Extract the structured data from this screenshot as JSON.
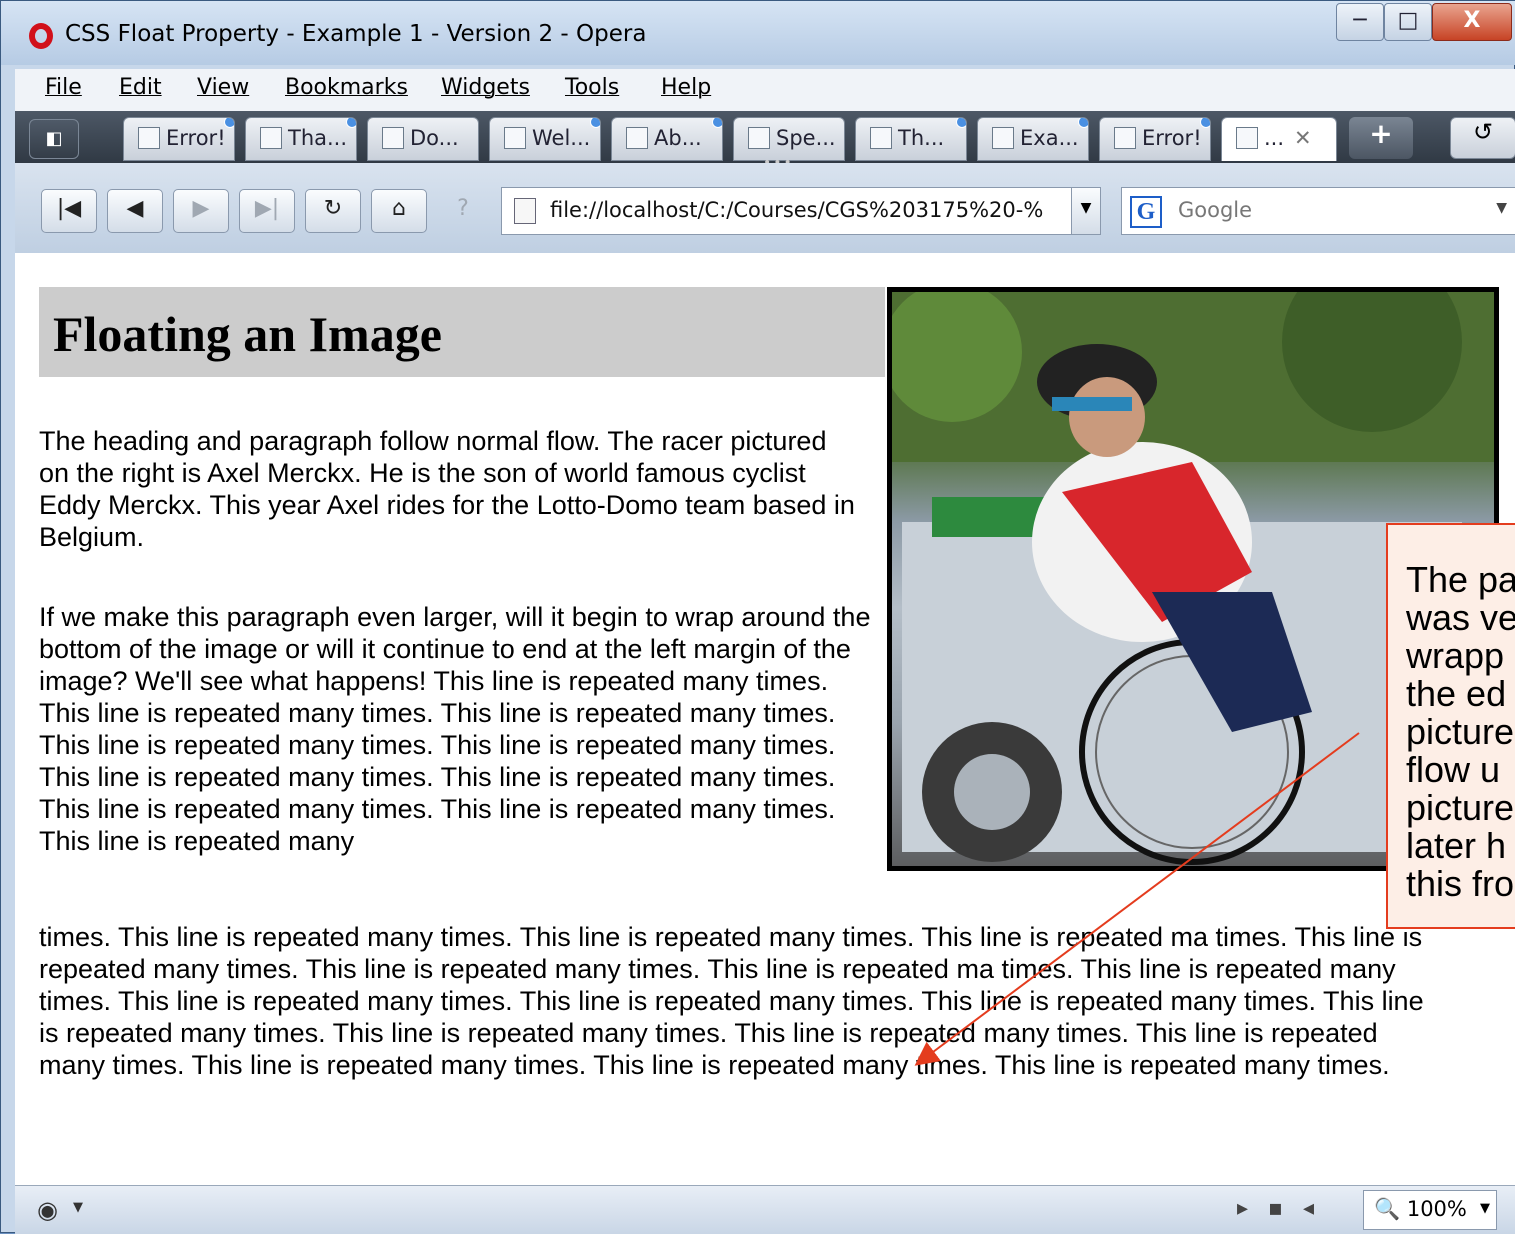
{
  "window": {
    "title": "CSS Float Property - Example 1 - Version 2 - Opera",
    "min": "─",
    "max": "□",
    "close": "X"
  },
  "menu": [
    "File",
    "Edit",
    "View",
    "Bookmarks",
    "Widgets",
    "Tools",
    "Help"
  ],
  "tabs": [
    "Error!",
    "Tha...",
    "Do...",
    "Wel...",
    "Ab...",
    "Spe...",
    "Th...",
    "Exa...",
    "Error!",
    "..."
  ],
  "tabbar": {
    "panel": "◧",
    "new_tab": "+",
    "trash": "↺",
    "more": "•••"
  },
  "nav": {
    "first": "|◀",
    "back": "◀",
    "forward": "▶",
    "last": "▶|",
    "reload": "↻",
    "home": "⌂",
    "wand": "?"
  },
  "address": {
    "url": "file://localhost/C:/Courses/CGS%203175%20-%"
  },
  "search": {
    "engine": "G",
    "placeholder": "Google"
  },
  "page": {
    "heading": "Floating an Image",
    "para1": "The heading and paragraph follow normal flow. The racer pictured on the right is Axel Merckx. He is the son of world famous cyclist Eddy Merckx. This year Axel rides for the Lotto-Domo team based in Belgium.",
    "para2": "If we make this paragraph even larger, will it begin to wrap around the bottom of the image or will it continue to end at the left margin of the image? We'll see what happens! This line is repeated many times. This line is repeated many times. This line is repeated many times. This line is repeated many times. This line is repeated many times. This line is repeated many times. This line is repeated many times. This line is repeated many times. This line is repeated many times. This line is repeated many",
    "para2_rest": "times. This line is repeated many times. This line is repeated many times. This line is repeated ma times. This line is repeated many times. This line is repeated many times. This line is repeated ma times. This line is repeated many times. This line is repeated many times. This line is repeated many times. This line is repeated many times. This line is repeated many times. This line is repeated many times. This line is repeated many times. This line is repeated many times. This line is repeated many times. This line is repeated many times. This line is repeated many times."
  },
  "callout": {
    "lines": [
      "The pa",
      "was ve",
      "wrapp",
      "the ed",
      "picture",
      "flow u",
      "picture",
      "later h",
      "this fro"
    ]
  },
  "status": {
    "zoom": "100%"
  },
  "colors": {
    "callout_border": "#e43c1e",
    "heading_bg": "#cccccc",
    "opera_red": "#d1101a"
  }
}
